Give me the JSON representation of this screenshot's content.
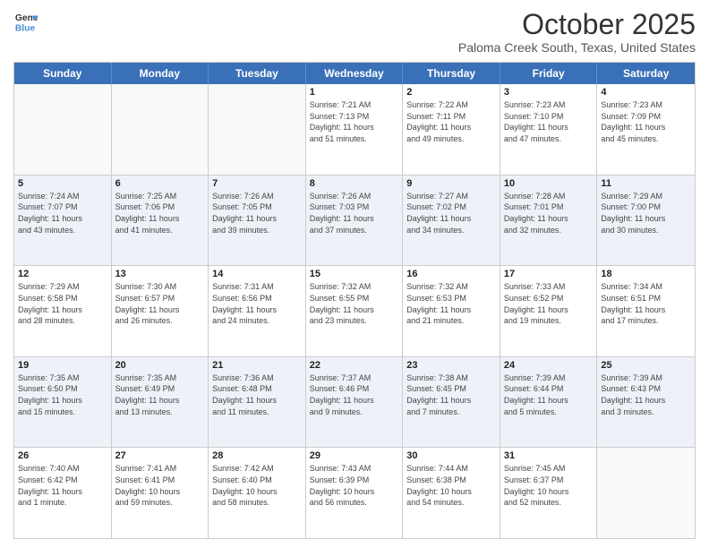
{
  "header": {
    "logo_line1": "General",
    "logo_line2": "Blue",
    "month": "October 2025",
    "location": "Paloma Creek South, Texas, United States"
  },
  "days_of_week": [
    "Sunday",
    "Monday",
    "Tuesday",
    "Wednesday",
    "Thursday",
    "Friday",
    "Saturday"
  ],
  "weeks": [
    [
      {
        "day": "",
        "info": ""
      },
      {
        "day": "",
        "info": ""
      },
      {
        "day": "",
        "info": ""
      },
      {
        "day": "1",
        "info": "Sunrise: 7:21 AM\nSunset: 7:13 PM\nDaylight: 11 hours\nand 51 minutes."
      },
      {
        "day": "2",
        "info": "Sunrise: 7:22 AM\nSunset: 7:11 PM\nDaylight: 11 hours\nand 49 minutes."
      },
      {
        "day": "3",
        "info": "Sunrise: 7:23 AM\nSunset: 7:10 PM\nDaylight: 11 hours\nand 47 minutes."
      },
      {
        "day": "4",
        "info": "Sunrise: 7:23 AM\nSunset: 7:09 PM\nDaylight: 11 hours\nand 45 minutes."
      }
    ],
    [
      {
        "day": "5",
        "info": "Sunrise: 7:24 AM\nSunset: 7:07 PM\nDaylight: 11 hours\nand 43 minutes."
      },
      {
        "day": "6",
        "info": "Sunrise: 7:25 AM\nSunset: 7:06 PM\nDaylight: 11 hours\nand 41 minutes."
      },
      {
        "day": "7",
        "info": "Sunrise: 7:26 AM\nSunset: 7:05 PM\nDaylight: 11 hours\nand 39 minutes."
      },
      {
        "day": "8",
        "info": "Sunrise: 7:26 AM\nSunset: 7:03 PM\nDaylight: 11 hours\nand 37 minutes."
      },
      {
        "day": "9",
        "info": "Sunrise: 7:27 AM\nSunset: 7:02 PM\nDaylight: 11 hours\nand 34 minutes."
      },
      {
        "day": "10",
        "info": "Sunrise: 7:28 AM\nSunset: 7:01 PM\nDaylight: 11 hours\nand 32 minutes."
      },
      {
        "day": "11",
        "info": "Sunrise: 7:29 AM\nSunset: 7:00 PM\nDaylight: 11 hours\nand 30 minutes."
      }
    ],
    [
      {
        "day": "12",
        "info": "Sunrise: 7:29 AM\nSunset: 6:58 PM\nDaylight: 11 hours\nand 28 minutes."
      },
      {
        "day": "13",
        "info": "Sunrise: 7:30 AM\nSunset: 6:57 PM\nDaylight: 11 hours\nand 26 minutes."
      },
      {
        "day": "14",
        "info": "Sunrise: 7:31 AM\nSunset: 6:56 PM\nDaylight: 11 hours\nand 24 minutes."
      },
      {
        "day": "15",
        "info": "Sunrise: 7:32 AM\nSunset: 6:55 PM\nDaylight: 11 hours\nand 23 minutes."
      },
      {
        "day": "16",
        "info": "Sunrise: 7:32 AM\nSunset: 6:53 PM\nDaylight: 11 hours\nand 21 minutes."
      },
      {
        "day": "17",
        "info": "Sunrise: 7:33 AM\nSunset: 6:52 PM\nDaylight: 11 hours\nand 19 minutes."
      },
      {
        "day": "18",
        "info": "Sunrise: 7:34 AM\nSunset: 6:51 PM\nDaylight: 11 hours\nand 17 minutes."
      }
    ],
    [
      {
        "day": "19",
        "info": "Sunrise: 7:35 AM\nSunset: 6:50 PM\nDaylight: 11 hours\nand 15 minutes."
      },
      {
        "day": "20",
        "info": "Sunrise: 7:35 AM\nSunset: 6:49 PM\nDaylight: 11 hours\nand 13 minutes."
      },
      {
        "day": "21",
        "info": "Sunrise: 7:36 AM\nSunset: 6:48 PM\nDaylight: 11 hours\nand 11 minutes."
      },
      {
        "day": "22",
        "info": "Sunrise: 7:37 AM\nSunset: 6:46 PM\nDaylight: 11 hours\nand 9 minutes."
      },
      {
        "day": "23",
        "info": "Sunrise: 7:38 AM\nSunset: 6:45 PM\nDaylight: 11 hours\nand 7 minutes."
      },
      {
        "day": "24",
        "info": "Sunrise: 7:39 AM\nSunset: 6:44 PM\nDaylight: 11 hours\nand 5 minutes."
      },
      {
        "day": "25",
        "info": "Sunrise: 7:39 AM\nSunset: 6:43 PM\nDaylight: 11 hours\nand 3 minutes."
      }
    ],
    [
      {
        "day": "26",
        "info": "Sunrise: 7:40 AM\nSunset: 6:42 PM\nDaylight: 11 hours\nand 1 minute."
      },
      {
        "day": "27",
        "info": "Sunrise: 7:41 AM\nSunset: 6:41 PM\nDaylight: 10 hours\nand 59 minutes."
      },
      {
        "day": "28",
        "info": "Sunrise: 7:42 AM\nSunset: 6:40 PM\nDaylight: 10 hours\nand 58 minutes."
      },
      {
        "day": "29",
        "info": "Sunrise: 7:43 AM\nSunset: 6:39 PM\nDaylight: 10 hours\nand 56 minutes."
      },
      {
        "day": "30",
        "info": "Sunrise: 7:44 AM\nSunset: 6:38 PM\nDaylight: 10 hours\nand 54 minutes."
      },
      {
        "day": "31",
        "info": "Sunrise: 7:45 AM\nSunset: 6:37 PM\nDaylight: 10 hours\nand 52 minutes."
      },
      {
        "day": "",
        "info": ""
      }
    ]
  ]
}
